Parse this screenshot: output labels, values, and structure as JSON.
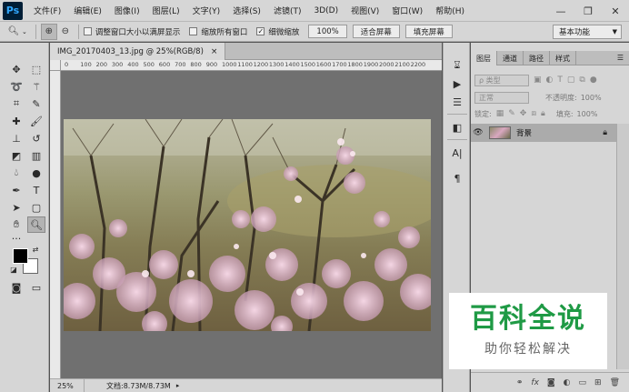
{
  "app": {
    "logo": "Ps"
  },
  "menu": [
    "文件(F)",
    "编辑(E)",
    "图像(I)",
    "图层(L)",
    "文字(Y)",
    "选择(S)",
    "滤镜(T)",
    "3D(D)",
    "视图(V)",
    "窗口(W)",
    "帮助(H)"
  ],
  "window_controls": {
    "minimize": "—",
    "restore": "❐",
    "close": "✕"
  },
  "options_bar": {
    "resize_windows_label": "调整窗口大小以满屏显示",
    "zoom_all_label": "缩放所有窗口",
    "scrubby_zoom_label": "细微缩放",
    "zoom_percent": "100%",
    "fit_screen": "适合屏幕",
    "fill_screen": "填充屏幕",
    "workspace": "基本功能"
  },
  "document": {
    "tab_title": "IMG_20170403_13.jpg @ 25%(RGB/8)",
    "close": "×"
  },
  "rulers": {
    "top": [
      "0",
      "100",
      "200",
      "300",
      "400",
      "500",
      "600",
      "700",
      "800",
      "900",
      "1000",
      "1100",
      "1200",
      "1300",
      "1400",
      "1500",
      "1600",
      "1700",
      "1800",
      "1900",
      "2000",
      "2100",
      "2200"
    ]
  },
  "status": {
    "zoom": "25%",
    "doc_info": "文档:8.73M/8.73M",
    "arrow": "▸"
  },
  "layers_panel": {
    "tabs": [
      "图层",
      "通道",
      "路径",
      "样式"
    ],
    "active_tab": 0,
    "kind_filter": "ρ 类型",
    "blend_mode": "正常",
    "opacity_label": "不透明度:",
    "opacity_value": "100%",
    "lock_label": "锁定:",
    "fill_label": "填充:",
    "fill_value": "100%",
    "layer": {
      "name": "背景",
      "visible_icon": "eye-icon",
      "locked": true
    }
  },
  "watermark": {
    "title": "百科全说",
    "subtitle": "助你轻松解决"
  },
  "colors": {
    "foreground": "#000000",
    "background": "#ffffff",
    "accent": "#1f9a45"
  }
}
